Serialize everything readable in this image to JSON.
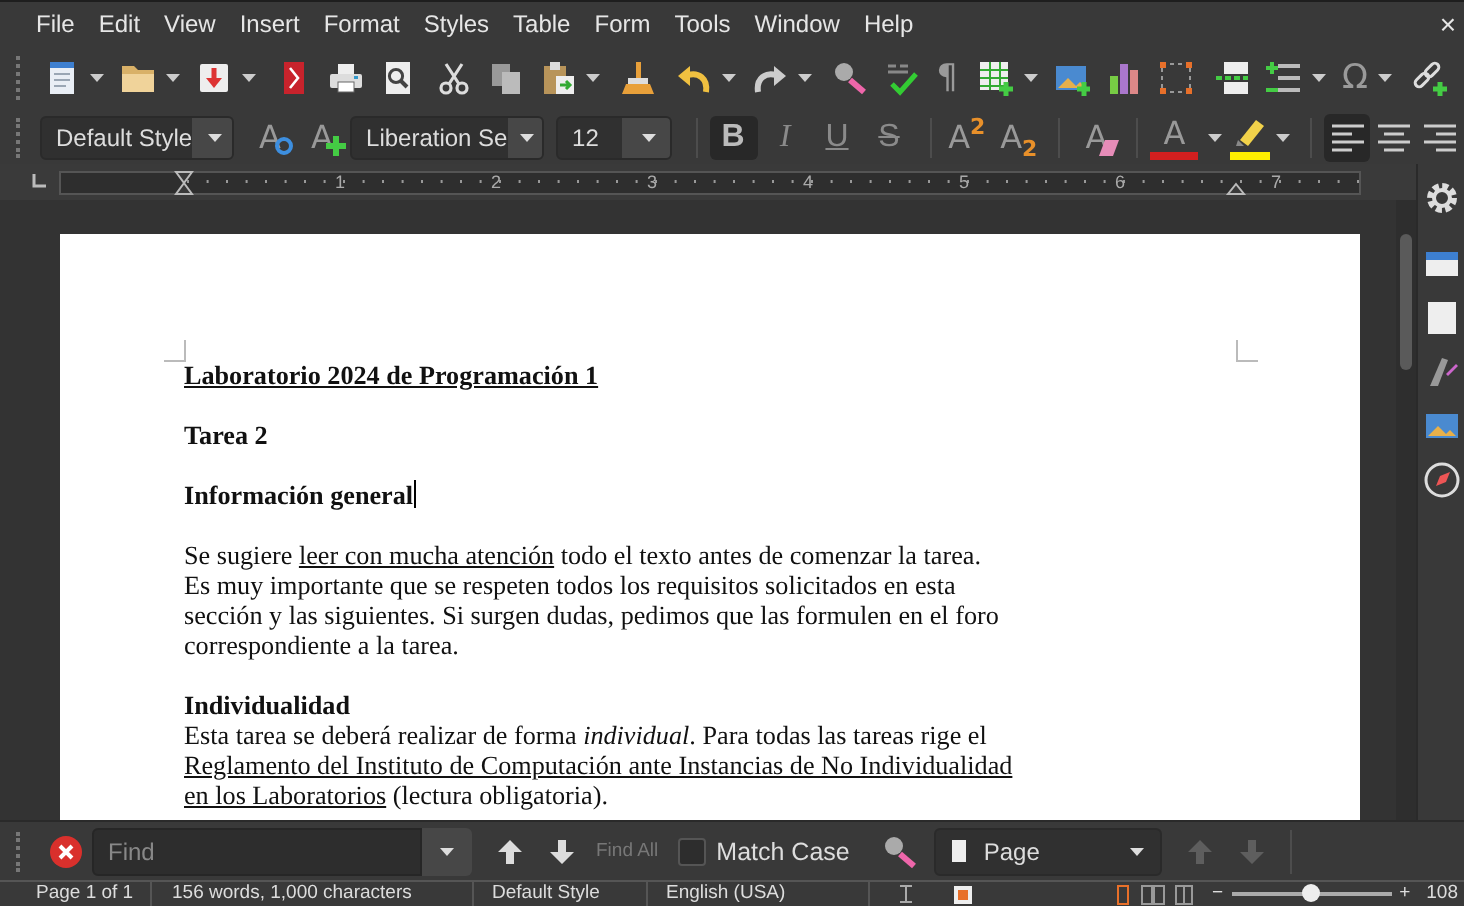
{
  "menu": [
    "File",
    "Edit",
    "View",
    "Insert",
    "Format",
    "Styles",
    "Table",
    "Form",
    "Tools",
    "Window",
    "Help"
  ],
  "window_close": "×",
  "standard_toolbar": [
    {
      "kind": "new-document",
      "dropdown": true
    },
    {
      "kind": "open",
      "dropdown": true
    },
    {
      "kind": "save",
      "dropdown": true
    },
    {
      "kind": "separator"
    },
    {
      "kind": "export-pdf"
    },
    {
      "kind": "print"
    },
    {
      "kind": "print-preview"
    },
    {
      "kind": "separator"
    },
    {
      "kind": "cut"
    },
    {
      "kind": "copy"
    },
    {
      "kind": "paste",
      "dropdown": true
    },
    {
      "kind": "separator"
    },
    {
      "kind": "clone-formatting"
    },
    {
      "kind": "separator"
    },
    {
      "kind": "undo",
      "dropdown": true
    },
    {
      "kind": "redo",
      "dropdown": true
    },
    {
      "kind": "separator"
    },
    {
      "kind": "find-replace"
    },
    {
      "kind": "spelling"
    },
    {
      "kind": "formatting-marks",
      "glyph": "¶"
    },
    {
      "kind": "separator"
    },
    {
      "kind": "table",
      "dropdown": true
    },
    {
      "kind": "image"
    },
    {
      "kind": "chart"
    },
    {
      "kind": "text-box"
    },
    {
      "kind": "separator"
    },
    {
      "kind": "page-break"
    },
    {
      "kind": "field",
      "dropdown": true
    },
    {
      "kind": "special-character",
      "glyph": "Ω",
      "dropdown": true
    },
    {
      "kind": "separator"
    },
    {
      "kind": "hyperlink"
    }
  ],
  "format_toolbar": [
    {
      "kind": "style-box",
      "value": "Default Style"
    },
    {
      "kind": "update-style",
      "glyph": "A"
    },
    {
      "kind": "new-style",
      "glyph": "A"
    },
    {
      "kind": "font-box",
      "value": "Liberation Se"
    },
    {
      "kind": "size-box",
      "value": "12"
    },
    {
      "kind": "separator"
    },
    {
      "kind": "bold",
      "glyph": "B",
      "on": true
    },
    {
      "kind": "italic",
      "glyph": "I",
      "on": false
    },
    {
      "kind": "underline",
      "glyph": "U",
      "on": false
    },
    {
      "kind": "strikethrough",
      "glyph": "S",
      "on": false
    },
    {
      "kind": "separator"
    },
    {
      "kind": "superscript",
      "glyph": "A",
      "index": "2"
    },
    {
      "kind": "subscript",
      "glyph": "A",
      "index": "2"
    },
    {
      "kind": "separator"
    },
    {
      "kind": "clear-formatting",
      "glyph": "A"
    },
    {
      "kind": "separator"
    },
    {
      "kind": "font-color",
      "glyph": "A",
      "dropdown": true
    },
    {
      "kind": "highlight",
      "dropdown": true
    },
    {
      "kind": "separator"
    },
    {
      "kind": "align-left",
      "on": true
    },
    {
      "kind": "align-center",
      "on": false
    },
    {
      "kind": "align-right",
      "on": false
    }
  ],
  "ruler": {
    "numbers": [
      "1",
      "2",
      "3",
      "4",
      "5",
      "6",
      "7"
    ]
  },
  "document": {
    "sections": [
      {
        "blocks": [
          {
            "kind": "title",
            "text": "Laboratorio 2024 de Programación 1"
          }
        ]
      },
      {
        "blocks": [
          {
            "kind": "heading",
            "text": "Tarea 2"
          }
        ]
      },
      {
        "blocks": [
          {
            "kind": "heading",
            "text": "Información general",
            "caret": true
          }
        ]
      },
      {
        "blocks": [
          {
            "kind": "paragraph",
            "lines": [
              [
                {
                  "kind": "plain",
                  "text": "Se sugiere "
                },
                {
                  "kind": "link",
                  "text": "leer con mucha atención"
                },
                {
                  "kind": "plain",
                  "text": " todo el texto antes de comenzar la tarea."
                }
              ],
              [
                {
                  "kind": "plain",
                  "text": "Es muy importante que se respeten todos los requisitos solicitados en esta"
                }
              ],
              [
                {
                  "kind": "plain",
                  "text": "sección y las siguientes. Si surgen dudas, pedimos que las formulen en el foro"
                }
              ],
              [
                {
                  "kind": "plain",
                  "text": "correspondiente a la tarea."
                }
              ]
            ]
          }
        ]
      },
      {
        "blocks": [
          {
            "kind": "heading",
            "text": "Individualidad"
          },
          {
            "kind": "paragraph",
            "lines": [
              [
                {
                  "kind": "plain",
                  "text": "Esta tarea se deberá realizar de forma *individual*. Para todas las tareas rige el"
                }
              ],
              [
                {
                  "kind": "link",
                  "text": "Reglamento del Instituto de Computación ante Instancias de No Individualidad"
                }
              ],
              [
                {
                  "kind": "link",
                  "text": "en los Laboratorios"
                },
                {
                  "kind": "plain",
                  "text": " (lectura obligatoria)."
                }
              ]
            ]
          }
        ]
      }
    ]
  },
  "sidebar": [
    {
      "kind": "settings"
    },
    {
      "kind": "properties"
    },
    {
      "kind": "page"
    },
    {
      "kind": "styles"
    },
    {
      "kind": "gallery"
    },
    {
      "kind": "navigator"
    }
  ],
  "find_bar": {
    "placeholder": "Find",
    "find_all": "Find All",
    "find_all_disabled": true,
    "match_case": {
      "label": "Match Case",
      "checked": false
    },
    "search_by": "Page",
    "navigate_disabled": true
  },
  "status_bar": {
    "page": "Page 1 of 1",
    "word_count": "156 words, 1,000 characters",
    "page_style": "Default Style",
    "language": "English (USA)",
    "zoom": {
      "minus": "−",
      "plus": "+",
      "level": 0.5,
      "reading": "108"
    }
  }
}
